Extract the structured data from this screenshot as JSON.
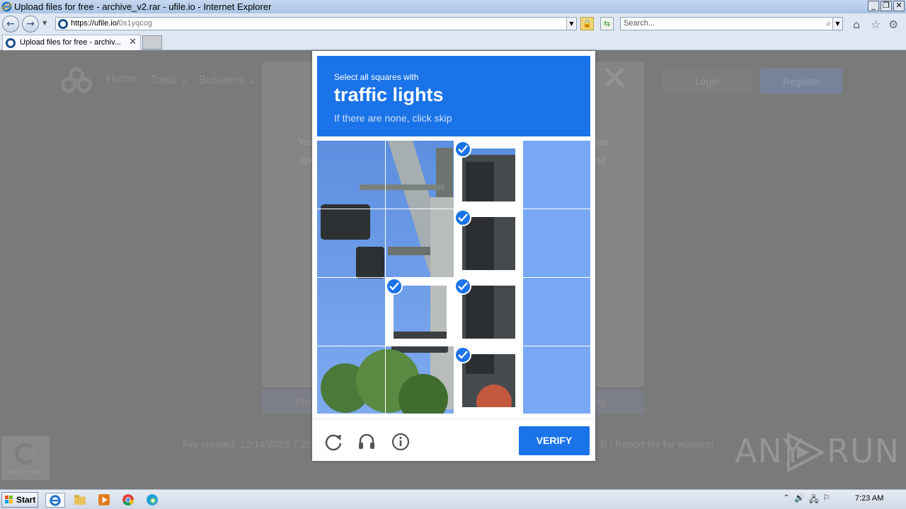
{
  "window": {
    "title": "Upload files for free - archive_v2.rar - ufile.io - Internet Explorer",
    "controls": [
      "_",
      "❐",
      "✕"
    ]
  },
  "address_bar": {
    "url_host": "https://ufile.io/",
    "url_path": "0s1yqcog",
    "search_placeholder": "Search..."
  },
  "tabs": [
    {
      "label": "Upload files for free - archiv...",
      "close": "✕"
    }
  ],
  "background_page": {
    "nav": [
      "Home",
      "Tools ⌄",
      "Business ⌄"
    ],
    "login": "Login",
    "register": "Register",
    "modal_fragments": {
      "left1": "You",
      "left2": "spe",
      "right1": "fair",
      "right2": "nd"
    },
    "free_text": "Fre",
    "speed_text": "/s)",
    "file_created": "File created: 12/14/2023 7:22",
    "report_text": "B  |   Report file for violation",
    "recaptcha_text": "Privacy - Terms",
    "watermark_left": "ANY",
    "watermark_right": "RUN"
  },
  "challenge": {
    "prompt_line1": "Select all squares with",
    "prompt_target": "traffic lights",
    "prompt_line3": "If there are none, click skip",
    "selected_tiles": [
      2,
      6,
      9,
      10,
      14
    ],
    "verify_label": "VERIFY",
    "accent_color": "#1a73e8"
  },
  "taskbar": {
    "start_label": "Start",
    "clock": "7:23 AM"
  }
}
